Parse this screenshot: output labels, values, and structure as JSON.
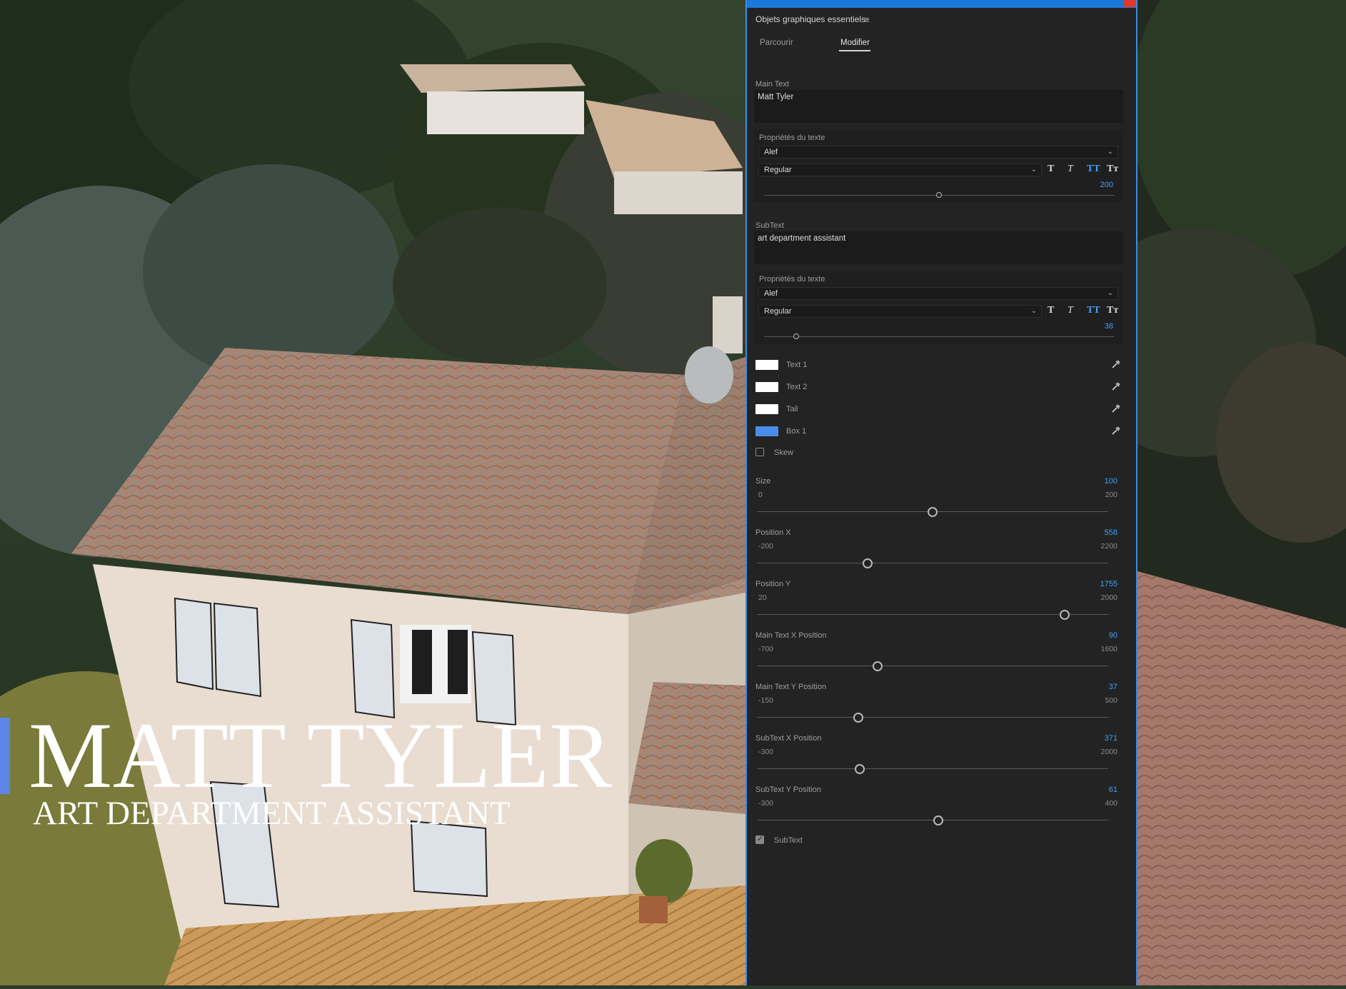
{
  "overlay": {
    "main_title": "MATT TYLER",
    "sub_title": "ART DEPARTMENT ASSISTANT",
    "accent_color": "#5a86e6"
  },
  "panel": {
    "title": "Objets graphiques essentiels",
    "menu_icon": "hamburger-icon",
    "tabs": [
      {
        "label": "Parcourir",
        "active": false
      },
      {
        "label": "Modifier",
        "active": true
      }
    ],
    "main_text": {
      "label": "Main Text",
      "value": "Matt Tyler",
      "props_label": "Propriétés du texte",
      "font": "Alef",
      "style": "Regular",
      "size_value": "200",
      "size_fraction": 0.5
    },
    "sub_text": {
      "label": "SubText",
      "value": "art department assistant",
      "props_label": "Propriétés du texte",
      "font": "Alef",
      "style": "Regular",
      "size_value": "38",
      "size_fraction": 0.095
    },
    "style_buttons": [
      "T",
      "T",
      "TT",
      "Tт"
    ],
    "colors": [
      {
        "label": "Text 1",
        "color": "#ffffff"
      },
      {
        "label": "Text 2",
        "color": "#ffffff"
      },
      {
        "label": "Tail",
        "color": "#ffffff"
      },
      {
        "label": "Box 1",
        "color": "#4a8de8"
      }
    ],
    "skew": {
      "label": "Skew",
      "checked": false
    },
    "sliders": [
      {
        "label": "Size",
        "value": "100",
        "min": "0",
        "max": "200",
        "fraction": 0.5
      },
      {
        "label": "Position X",
        "value": "558",
        "min": "-200",
        "max": "2200",
        "fraction": 0.316
      },
      {
        "label": "Position Y",
        "value": "1755",
        "min": "20",
        "max": "2000",
        "fraction": 0.876
      },
      {
        "label": "Main Text X Position",
        "value": "90",
        "min": "-700",
        "max": "1600",
        "fraction": 0.343
      },
      {
        "label": "Main Text Y  Position",
        "value": "37",
        "min": "-150",
        "max": "500",
        "fraction": 0.288
      },
      {
        "label": "SubText X Position",
        "value": "371",
        "min": "-300",
        "max": "2000",
        "fraction": 0.292
      },
      {
        "label": "SubText  Y Position",
        "value": "61",
        "min": "-300",
        "max": "400",
        "fraction": 0.516
      }
    ],
    "subtext_toggle": {
      "label": "SubText",
      "checked": true
    }
  }
}
